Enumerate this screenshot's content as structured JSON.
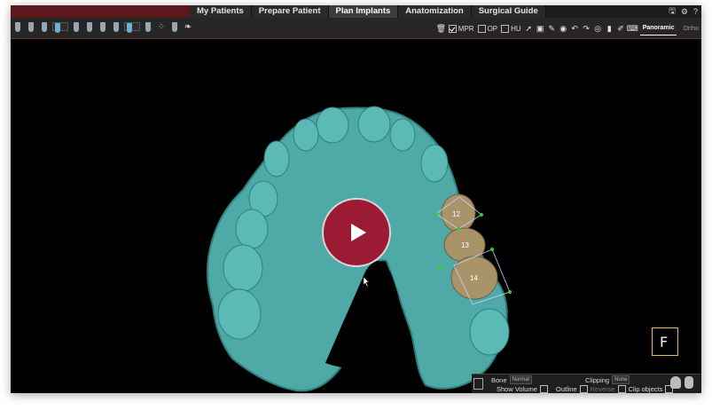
{
  "tabs": [
    "My Patients",
    "Prepare Patient",
    "Plan Implants",
    "Anatomization",
    "Surgical Guide"
  ],
  "active_tab": "Plan Implants",
  "window_controls": {
    "save": "🖫",
    "settings": "⚙",
    "help": "?"
  },
  "toolbar": {
    "checks": [
      {
        "label": "MPR",
        "checked": true
      },
      {
        "label": "OP",
        "checked": false
      },
      {
        "label": "HU",
        "checked": false
      }
    ],
    "view_tabs": [
      "Panoramic",
      "Ortho"
    ]
  },
  "teeth_labels": [
    "12",
    "13",
    "14"
  ],
  "orientation_label": "F",
  "bottom_panel": {
    "bone_label": "Bone",
    "bone_value": "Normal",
    "clipping_label": "Clipping",
    "clipping_value": "None",
    "show_volume": "Show Volume",
    "outline": "Outline",
    "reverse": "Reverse",
    "clip_objects": "Clip objects"
  },
  "colors": {
    "brand": "#5a1a1c",
    "play": "#9b1b34",
    "jaw": "#4fa9a6",
    "crown": "#a9946a"
  }
}
